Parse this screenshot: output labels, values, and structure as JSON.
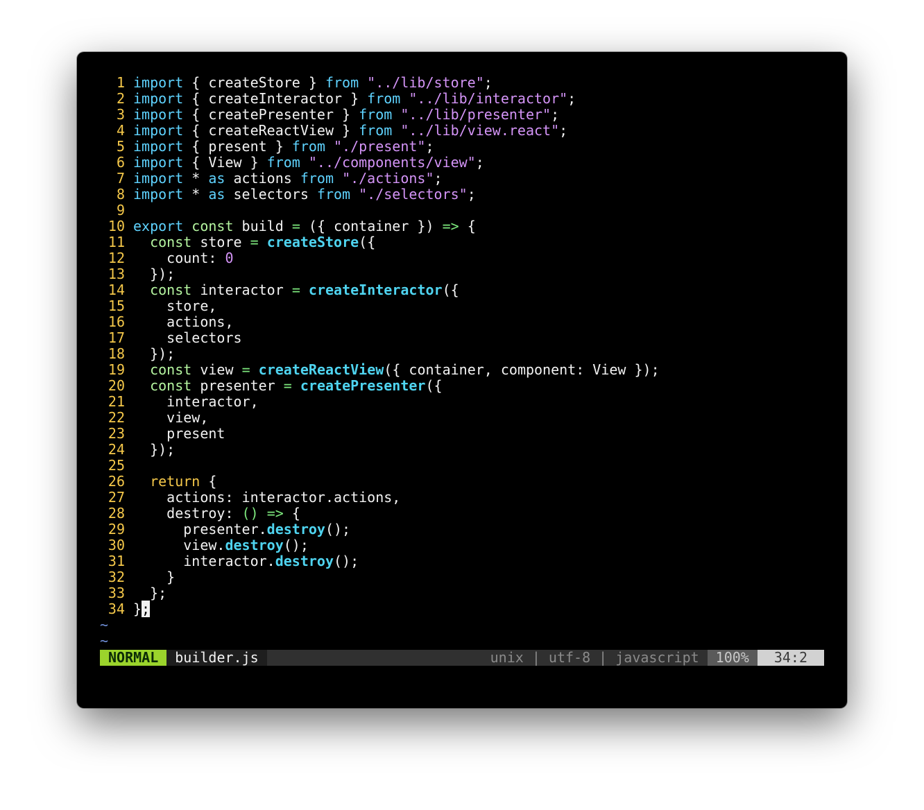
{
  "editor": {
    "lines": [
      {
        "n": "1",
        "tokens": [
          [
            "kw-import",
            "import"
          ],
          [
            "plain",
            " { createStore } "
          ],
          [
            "kw-from",
            "from"
          ],
          [
            "plain",
            " "
          ],
          [
            "str",
            "\"../lib/store\""
          ],
          [
            "plain",
            ";"
          ]
        ]
      },
      {
        "n": "2",
        "tokens": [
          [
            "kw-import",
            "import"
          ],
          [
            "plain",
            " { createInteractor } "
          ],
          [
            "kw-from",
            "from"
          ],
          [
            "plain",
            " "
          ],
          [
            "str",
            "\"../lib/interactor\""
          ],
          [
            "plain",
            ";"
          ]
        ]
      },
      {
        "n": "3",
        "tokens": [
          [
            "kw-import",
            "import"
          ],
          [
            "plain",
            " { createPresenter } "
          ],
          [
            "kw-from",
            "from"
          ],
          [
            "plain",
            " "
          ],
          [
            "str",
            "\"../lib/presenter\""
          ],
          [
            "plain",
            ";"
          ]
        ]
      },
      {
        "n": "4",
        "tokens": [
          [
            "kw-import",
            "import"
          ],
          [
            "plain",
            " { createReactView } "
          ],
          [
            "kw-from",
            "from"
          ],
          [
            "plain",
            " "
          ],
          [
            "str",
            "\"../lib/view.react\""
          ],
          [
            "plain",
            ";"
          ]
        ]
      },
      {
        "n": "5",
        "tokens": [
          [
            "kw-import",
            "import"
          ],
          [
            "plain",
            " { present } "
          ],
          [
            "kw-from",
            "from"
          ],
          [
            "plain",
            " "
          ],
          [
            "str",
            "\"./present\""
          ],
          [
            "plain",
            ";"
          ]
        ]
      },
      {
        "n": "6",
        "tokens": [
          [
            "kw-import",
            "import"
          ],
          [
            "plain",
            " { View } "
          ],
          [
            "kw-from",
            "from"
          ],
          [
            "plain",
            " "
          ],
          [
            "str",
            "\"../components/view\""
          ],
          [
            "plain",
            ";"
          ]
        ]
      },
      {
        "n": "7",
        "tokens": [
          [
            "kw-import",
            "import"
          ],
          [
            "plain",
            " * "
          ],
          [
            "kw-as",
            "as"
          ],
          [
            "plain",
            " actions "
          ],
          [
            "kw-from",
            "from"
          ],
          [
            "plain",
            " "
          ],
          [
            "str",
            "\"./actions\""
          ],
          [
            "plain",
            ";"
          ]
        ]
      },
      {
        "n": "8",
        "tokens": [
          [
            "kw-import",
            "import"
          ],
          [
            "plain",
            " * "
          ],
          [
            "kw-as",
            "as"
          ],
          [
            "plain",
            " selectors "
          ],
          [
            "kw-from",
            "from"
          ],
          [
            "plain",
            " "
          ],
          [
            "str",
            "\"./selectors\""
          ],
          [
            "plain",
            ";"
          ]
        ]
      },
      {
        "n": "9",
        "tokens": []
      },
      {
        "n": "10",
        "tokens": [
          [
            "kw-export",
            "export"
          ],
          [
            "plain",
            " "
          ],
          [
            "kw-const",
            "const"
          ],
          [
            "plain",
            " build "
          ],
          [
            "op",
            "="
          ],
          [
            "plain",
            " ({ container }) "
          ],
          [
            "op",
            "=>"
          ],
          [
            "plain",
            " {"
          ]
        ]
      },
      {
        "n": "11",
        "tokens": [
          [
            "plain",
            "  "
          ],
          [
            "kw-const",
            "const"
          ],
          [
            "plain",
            " store "
          ],
          [
            "op",
            "="
          ],
          [
            "plain",
            " "
          ],
          [
            "fn",
            "createStore"
          ],
          [
            "plain",
            "({"
          ]
        ]
      },
      {
        "n": "12",
        "tokens": [
          [
            "plain",
            "    count: "
          ],
          [
            "num",
            "0"
          ]
        ]
      },
      {
        "n": "13",
        "tokens": [
          [
            "plain",
            "  });"
          ]
        ]
      },
      {
        "n": "14",
        "tokens": [
          [
            "plain",
            "  "
          ],
          [
            "kw-const",
            "const"
          ],
          [
            "plain",
            " interactor "
          ],
          [
            "op",
            "="
          ],
          [
            "plain",
            " "
          ],
          [
            "fn",
            "createInteractor"
          ],
          [
            "plain",
            "({"
          ]
        ]
      },
      {
        "n": "15",
        "tokens": [
          [
            "plain",
            "    store,"
          ]
        ]
      },
      {
        "n": "16",
        "tokens": [
          [
            "plain",
            "    actions,"
          ]
        ]
      },
      {
        "n": "17",
        "tokens": [
          [
            "plain",
            "    selectors"
          ]
        ]
      },
      {
        "n": "18",
        "tokens": [
          [
            "plain",
            "  });"
          ]
        ]
      },
      {
        "n": "19",
        "tokens": [
          [
            "plain",
            "  "
          ],
          [
            "kw-const",
            "const"
          ],
          [
            "plain",
            " view "
          ],
          [
            "op",
            "="
          ],
          [
            "plain",
            " "
          ],
          [
            "fn",
            "createReactView"
          ],
          [
            "plain",
            "({ container, component: View });"
          ]
        ]
      },
      {
        "n": "20",
        "tokens": [
          [
            "plain",
            "  "
          ],
          [
            "kw-const",
            "const"
          ],
          [
            "plain",
            " presenter "
          ],
          [
            "op",
            "="
          ],
          [
            "plain",
            " "
          ],
          [
            "fn",
            "createPresenter"
          ],
          [
            "plain",
            "({"
          ]
        ]
      },
      {
        "n": "21",
        "tokens": [
          [
            "plain",
            "    interactor,"
          ]
        ]
      },
      {
        "n": "22",
        "tokens": [
          [
            "plain",
            "    view,"
          ]
        ]
      },
      {
        "n": "23",
        "tokens": [
          [
            "plain",
            "    present"
          ]
        ]
      },
      {
        "n": "24",
        "tokens": [
          [
            "plain",
            "  });"
          ]
        ]
      },
      {
        "n": "25",
        "tokens": []
      },
      {
        "n": "26",
        "tokens": [
          [
            "plain",
            "  "
          ],
          [
            "kw-return",
            "return"
          ],
          [
            "plain",
            " {"
          ]
        ]
      },
      {
        "n": "27",
        "tokens": [
          [
            "plain",
            "    actions: interactor.actions,"
          ]
        ]
      },
      {
        "n": "28",
        "tokens": [
          [
            "plain",
            "    destroy: "
          ],
          [
            "op",
            "()"
          ],
          [
            "plain",
            " "
          ],
          [
            "op",
            "=>"
          ],
          [
            "plain",
            " {"
          ]
        ]
      },
      {
        "n": "29",
        "tokens": [
          [
            "plain",
            "      presenter."
          ],
          [
            "fn",
            "destroy"
          ],
          [
            "plain",
            "();"
          ]
        ]
      },
      {
        "n": "30",
        "tokens": [
          [
            "plain",
            "      view."
          ],
          [
            "fn",
            "destroy"
          ],
          [
            "plain",
            "();"
          ]
        ]
      },
      {
        "n": "31",
        "tokens": [
          [
            "plain",
            "      interactor."
          ],
          [
            "fn",
            "destroy"
          ],
          [
            "plain",
            "();"
          ]
        ]
      },
      {
        "n": "32",
        "tokens": [
          [
            "plain",
            "    }"
          ]
        ]
      },
      {
        "n": "33",
        "tokens": [
          [
            "plain",
            "  };"
          ]
        ]
      },
      {
        "n": "34",
        "tokens": [
          [
            "plain",
            "}"
          ],
          [
            "cursor",
            ";"
          ]
        ]
      }
    ],
    "tildes": [
      "~",
      "~"
    ]
  },
  "statusline": {
    "mode": "NORMAL",
    "filename": "builder.js",
    "fileinfo": "unix | utf-8 | javascript",
    "percent": "100%",
    "position": "34:2"
  },
  "colors": {
    "background": "#000000",
    "line_number": "#f5c84a",
    "keyword": "#5fd3ff",
    "const": "#b5f5a0",
    "string": "#d494f7",
    "function": "#4fd4f0",
    "operator": "#7de87d",
    "mode_badge": "#9bd42c"
  }
}
